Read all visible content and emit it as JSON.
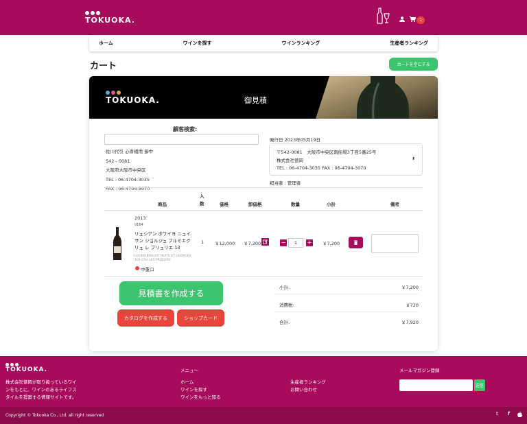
{
  "header": {
    "logo": "TOKUOKA.",
    "cart_count": "1"
  },
  "nav": {
    "items": [
      "ホーム",
      "ワインを探す",
      "ワインランキング",
      "生産者ランキング"
    ]
  },
  "page": {
    "title": "カート",
    "clear_cart": "カートを空にする"
  },
  "banner": {
    "logo": "TOKUOKA.",
    "title": "御見積"
  },
  "customer": {
    "search_label": "顧客検索:",
    "search_value": "",
    "name": "佐川代引 心斎橋用 御中",
    "zip": "542 - 0081",
    "address": "大阪府大阪市中央区",
    "tel": "TEL : 06-4704-3035",
    "fax": "FAX : 06-4704-3070"
  },
  "issuer": {
    "issue_date": "発行日 2023年05月19日",
    "address": "〒542-0081　大阪市中央区南船場3丁目5番25号",
    "company": "株式会社徳岡",
    "tel_fax": "TEL : 06-4704-3035 FAX : 06-4704-3070",
    "staff": "担当者 : 管理者"
  },
  "table": {
    "headers": {
      "product": "商品",
      "quantity_in": "入数",
      "price": "価格",
      "wholesale": "卸価格",
      "qty": "数量",
      "subtotal": "小計",
      "note": "備考"
    },
    "row": {
      "vintage": "2013",
      "code": "9164",
      "name": "リュシアン ボワイヨ ニュイ サン ジョルジュ プルミエクリュ レ プリュリエ 13",
      "name_en": "LUCIEN BOILLOT NUITS ST GEORGES 1ER CRU LES PRULIERS",
      "taste": "中重口",
      "quantity_in": "1",
      "price": "￥12,000",
      "wholesale": "￥7,200",
      "qty": "1",
      "subtotal": "￥7,200",
      "note": ""
    }
  },
  "actions": {
    "create_estimate": "見積書を作成する",
    "create_catalog": "カタログを作成する",
    "shop_card": "ショップカード"
  },
  "totals": {
    "subtotal_label": "小計:",
    "subtotal": "￥7,200",
    "tax_label": "消費税:",
    "tax": "￥720",
    "total_label": "合計:",
    "total": "￥7,920"
  },
  "footer": {
    "logo": "TOKUOKA.",
    "description": [
      "株式会社徳岡が取り扱っているワイ",
      "ンをもとに、ワインのあるライフス",
      "タイルを提案する情報サイトです。"
    ],
    "menu_title": "メニュー",
    "menu_col1": [
      "ホーム",
      "ワインを探す",
      "ワインをもっと知る"
    ],
    "menu_col2": [
      "生産者ランキング",
      "お問い合わせ"
    ],
    "newsletter_title": "メールマガジン登録",
    "newsletter_placeholder": "",
    "submit": "送信",
    "copyright": "Copyright © Tokuoka Co., Ltd. all right reserved"
  },
  "colors": {
    "brand": "#a80b5b",
    "green": "#3cc46e",
    "red": "#e8453c"
  }
}
